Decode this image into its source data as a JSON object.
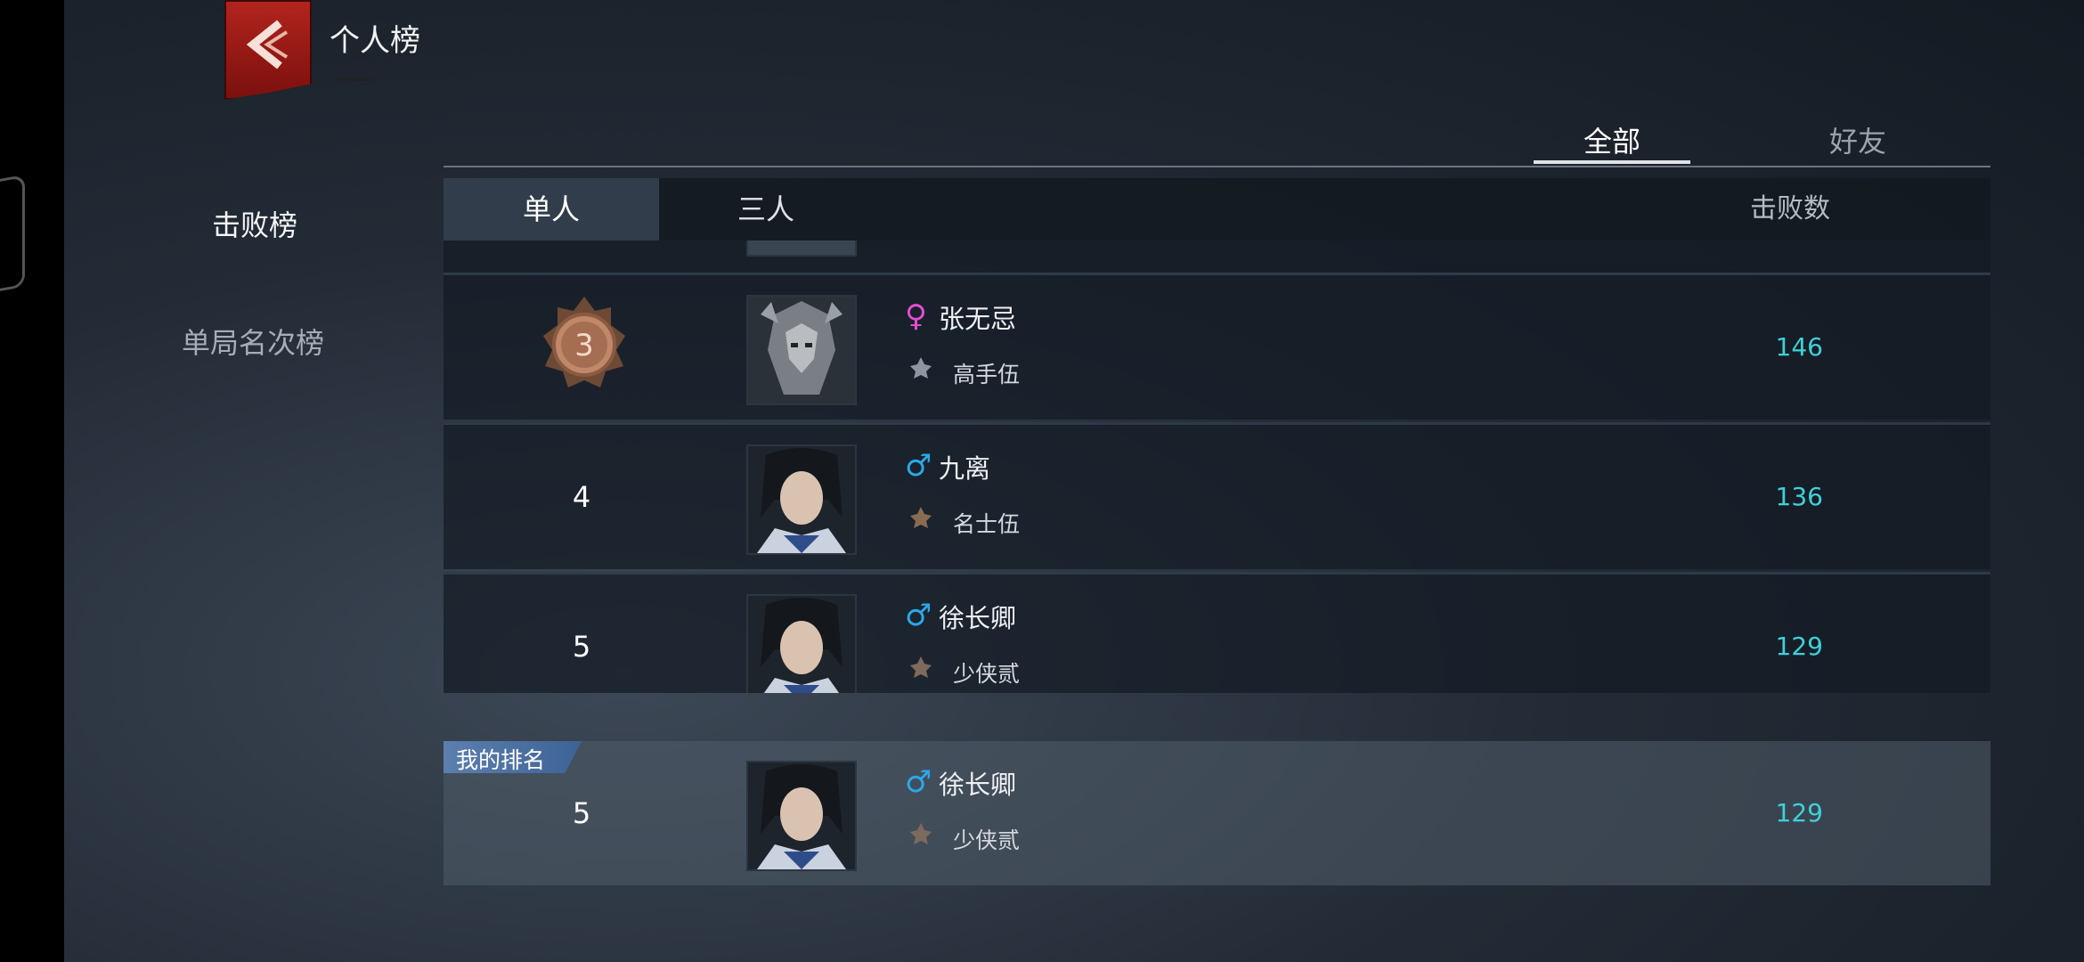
{
  "header": {
    "title": "个人榜",
    "back_icon": "back-chevron-icon"
  },
  "sidebar": {
    "items": [
      {
        "label": "击败榜",
        "active": true
      },
      {
        "label": "单局名次榜",
        "active": false
      }
    ]
  },
  "scope_tabs": [
    {
      "label": "全部",
      "active": true
    },
    {
      "label": "好友",
      "active": false
    }
  ],
  "mode_tabs": [
    {
      "label": "单人",
      "active": true
    },
    {
      "label": "三人",
      "active": false
    }
  ],
  "column_header": "击败数",
  "rows": [
    {
      "rank": "3",
      "medal": "bronze-medal-icon",
      "gender": "♀",
      "gender_type": "female",
      "name": "张无忌",
      "title": "高手伍",
      "score": "146",
      "avatar": "masked-warrior-avatar"
    },
    {
      "rank": "4",
      "gender": "♂",
      "gender_type": "male",
      "name": "九离",
      "title": "名士伍",
      "score": "136",
      "avatar": "swordsman-avatar"
    },
    {
      "rank": "5",
      "gender": "♂",
      "gender_type": "male",
      "name": "徐长卿",
      "title": "少侠贰",
      "score": "129",
      "avatar": "swordsman-avatar"
    }
  ],
  "my_rank": {
    "badge": "我的排名",
    "rank": "5",
    "gender": "♂",
    "gender_type": "male",
    "name": "徐长卿",
    "title": "少侠贰",
    "score": "129"
  },
  "colors": {
    "score": "#3fd0d8",
    "female": "#e14ed1",
    "male": "#2ba8ea",
    "back_button": "#b3241e"
  }
}
